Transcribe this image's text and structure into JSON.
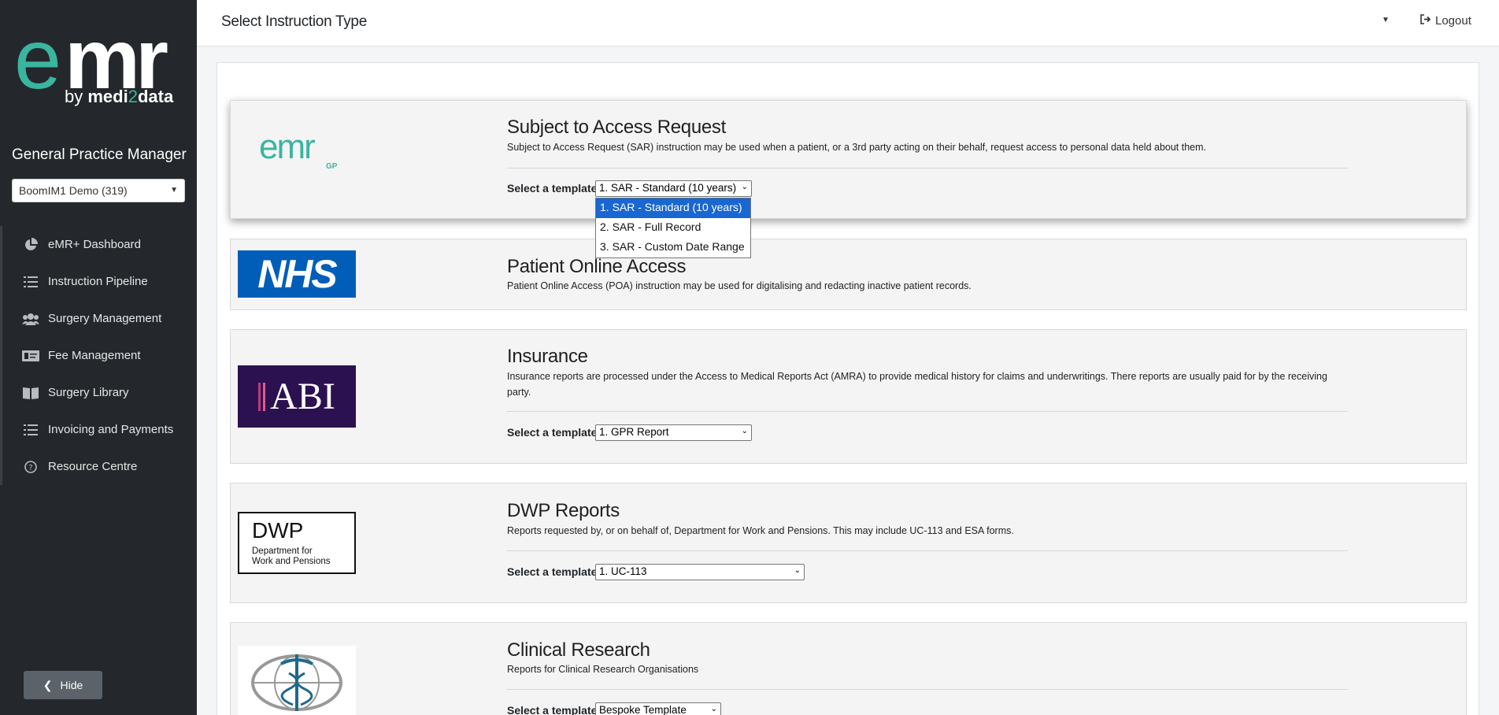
{
  "brand": {
    "e": "e",
    "mr": "mr",
    "by": "by ",
    "medi": "medi",
    "two": "2",
    "data": "data"
  },
  "sidebar": {
    "role_title": "General Practice Manager",
    "practice_select": "BoomIM1 Demo (319)",
    "items": [
      {
        "label": "eMR+ Dashboard",
        "icon": "pie-chart-icon"
      },
      {
        "label": "Instruction Pipeline",
        "icon": "list-icon"
      },
      {
        "label": "Surgery Management",
        "icon": "users-icon"
      },
      {
        "label": "Fee Management",
        "icon": "money-bill-icon"
      },
      {
        "label": "Surgery Library",
        "icon": "book-icon"
      },
      {
        "label": "Invoicing and Payments",
        "icon": "list-icon"
      },
      {
        "label": "Resource Centre",
        "icon": "question-circle-icon"
      }
    ],
    "hide_label": "Hide"
  },
  "topbar": {
    "title": "Select Instruction Type",
    "logout_label": "Logout"
  },
  "panels": [
    {
      "title": "Subject to Access Request",
      "description": "Subject to Access Request (SAR) instruction may be used when a patient, or a 3rd party acting on their behalf, request access to personal data held about them.",
      "template_label": "Select a template",
      "template_value": "1. SAR - Standard (10 years)",
      "logo": {
        "main": "emr",
        "sub": "GP"
      },
      "dropdown_options": [
        "1. SAR - Standard (10 years)",
        "2. SAR - Full Record",
        "3. SAR - Custom Date Range"
      ]
    },
    {
      "title": "Patient Online Access",
      "description": "Patient Online Access (POA) instruction may be used for digitalising and redacting inactive patient records.",
      "logo": {
        "text": "NHS"
      }
    },
    {
      "title": "Insurance",
      "description": "Insurance reports are processed under the Access to Medical Reports Act (AMRA) to provide medical history for claims and underwritings. There reports are usually paid for by the receiving party.",
      "template_label": "Select a template",
      "template_value": "1. GPR Report",
      "logo": {
        "text": "ABI"
      }
    },
    {
      "title": "DWP Reports",
      "description": "Reports requested by, or on behalf of, Department for Work and Pensions. This may include UC-113 and ESA forms.",
      "template_label": "Select a template",
      "template_value": "1. UC-113",
      "logo": {
        "text": "DWP",
        "line1": "Department for",
        "line2": "Work and Pensions"
      }
    },
    {
      "title": "Clinical Research",
      "description": "Reports for Clinical Research Organisations",
      "template_label": "Select a template",
      "template_value": "Bespoke Template",
      "logo": {
        "icon": "caduceus-globe-icon"
      }
    }
  ],
  "colors": {
    "sidebar_bg": "#24282c",
    "brand_teal": "#3ab5a0",
    "nhs_blue": "#005eb8",
    "abi_purple": "#2c1150",
    "dropdown_highlight": "#1967d2"
  }
}
